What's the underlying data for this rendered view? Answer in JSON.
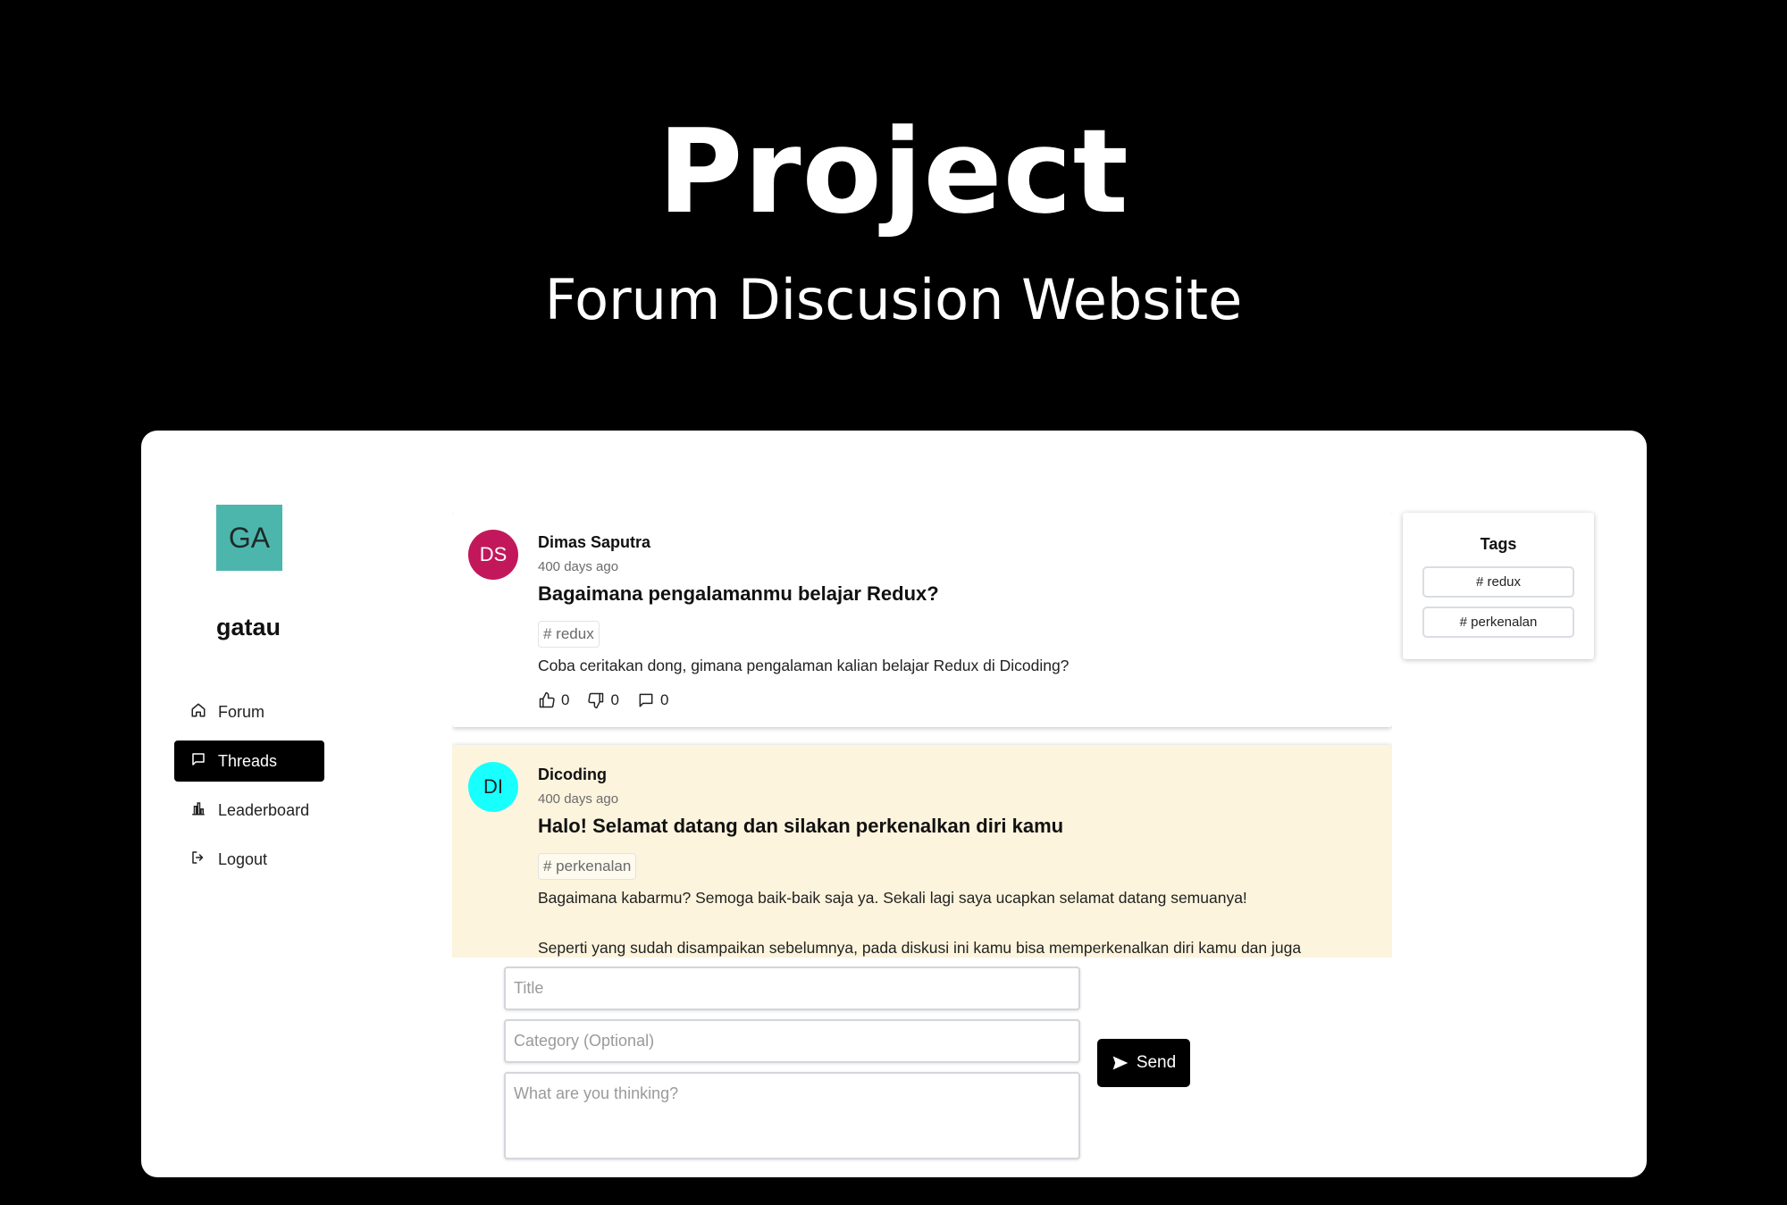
{
  "hero": {
    "title": "Project",
    "subtitle": "Forum Discusion Website"
  },
  "user": {
    "initials": "GA",
    "name": "gatau",
    "avatar_color": "#4db6ac"
  },
  "nav": {
    "items": [
      {
        "label": "Forum",
        "icon": "home-icon"
      },
      {
        "label": "Threads",
        "icon": "chat-bubble-icon",
        "active": true
      },
      {
        "label": "Leaderboard",
        "icon": "bar-chart-icon"
      },
      {
        "label": "Logout",
        "icon": "logout-icon"
      }
    ]
  },
  "threads": [
    {
      "initials": "DS",
      "avatar_color": "#c2185b",
      "author": "Dimas Saputra",
      "time": "400 days ago",
      "title": "Bagaimana pengalamanmu belajar Redux?",
      "tag": "# redux",
      "body": "Coba ceritakan dong, gimana pengalaman kalian belajar Redux di Dicoding?",
      "likes": "0",
      "dislikes": "0",
      "comments": "0",
      "background": "#ffffff"
    },
    {
      "initials": "DI",
      "avatar_color": "#18ffff",
      "author": "Dicoding",
      "time": "400 days ago",
      "title": "Halo! Selamat datang dan silakan perkenalkan diri kamu",
      "tag": "# perkenalan",
      "body_line1": "Bagaimana kabarmu? Semoga baik-baik saja ya. Sekali lagi saya ucapkan selamat datang semuanya!",
      "body_line2": "Seperti yang sudah disampaikan sebelumnya, pada diskusi ini kamu bisa memperkenalkan diri kamu dan juga",
      "background": "#fdf4dd"
    }
  ],
  "tags_panel": {
    "title": "Tags",
    "tags": [
      "# redux",
      "# perkenalan"
    ]
  },
  "form": {
    "title_placeholder": "Title",
    "category_placeholder": "Category (Optional)",
    "body_placeholder": "What are you thinking?",
    "send_label": "Send"
  }
}
